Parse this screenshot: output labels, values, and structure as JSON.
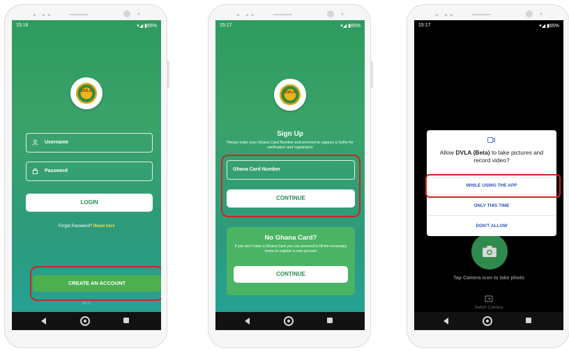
{
  "phone1": {
    "time": "15:16",
    "status_icons": "▾◢ ▮65%",
    "logo_text": "DVLA",
    "username_placeholder": "Username",
    "password_placeholder": "Password",
    "login_label": "LOGIN",
    "forgot_text": "Forgot Password?",
    "reset_link": "Reset here",
    "create_account_label": "CREATE AN ACCOUNT",
    "footer_text": "v2.0"
  },
  "phone2": {
    "time": "15:17",
    "status_icons": "▾◢ ▮65%",
    "logo_text": "DVLA",
    "title": "Sign Up",
    "subtitle": "Please enter your Ghana Card Number and proceed to capture a Selfie for verification and registration",
    "ghana_card_placeholder": "Ghana Card Number",
    "continue_label": "CONTINUE",
    "no_card_title": "No Ghana Card?",
    "no_card_text": "If you don't have a Ghana Card you can proceed to fill the necessary forms to register a new account",
    "no_card_continue_label": "CONTINUE"
  },
  "phone3": {
    "time": "15:17",
    "status_icons": "▾◢ ▮65%",
    "dialog_prefix": "Allow ",
    "dialog_app": "DVLA (Beta)",
    "dialog_suffix": " to take pictures and record video?",
    "option_while_using": "WHILE USING THE APP",
    "option_only_this_time": "ONLY THIS TIME",
    "option_dont_allow": "DON'T ALLOW",
    "camera_hint": "Tap Camera icon to take photo",
    "switch_camera": "Switch Camera"
  },
  "colors": {
    "accent_red": "#d02424",
    "green_primary": "#2e9b5e",
    "card_green": "#4bb364",
    "link_yellow": "#f2e04a"
  }
}
